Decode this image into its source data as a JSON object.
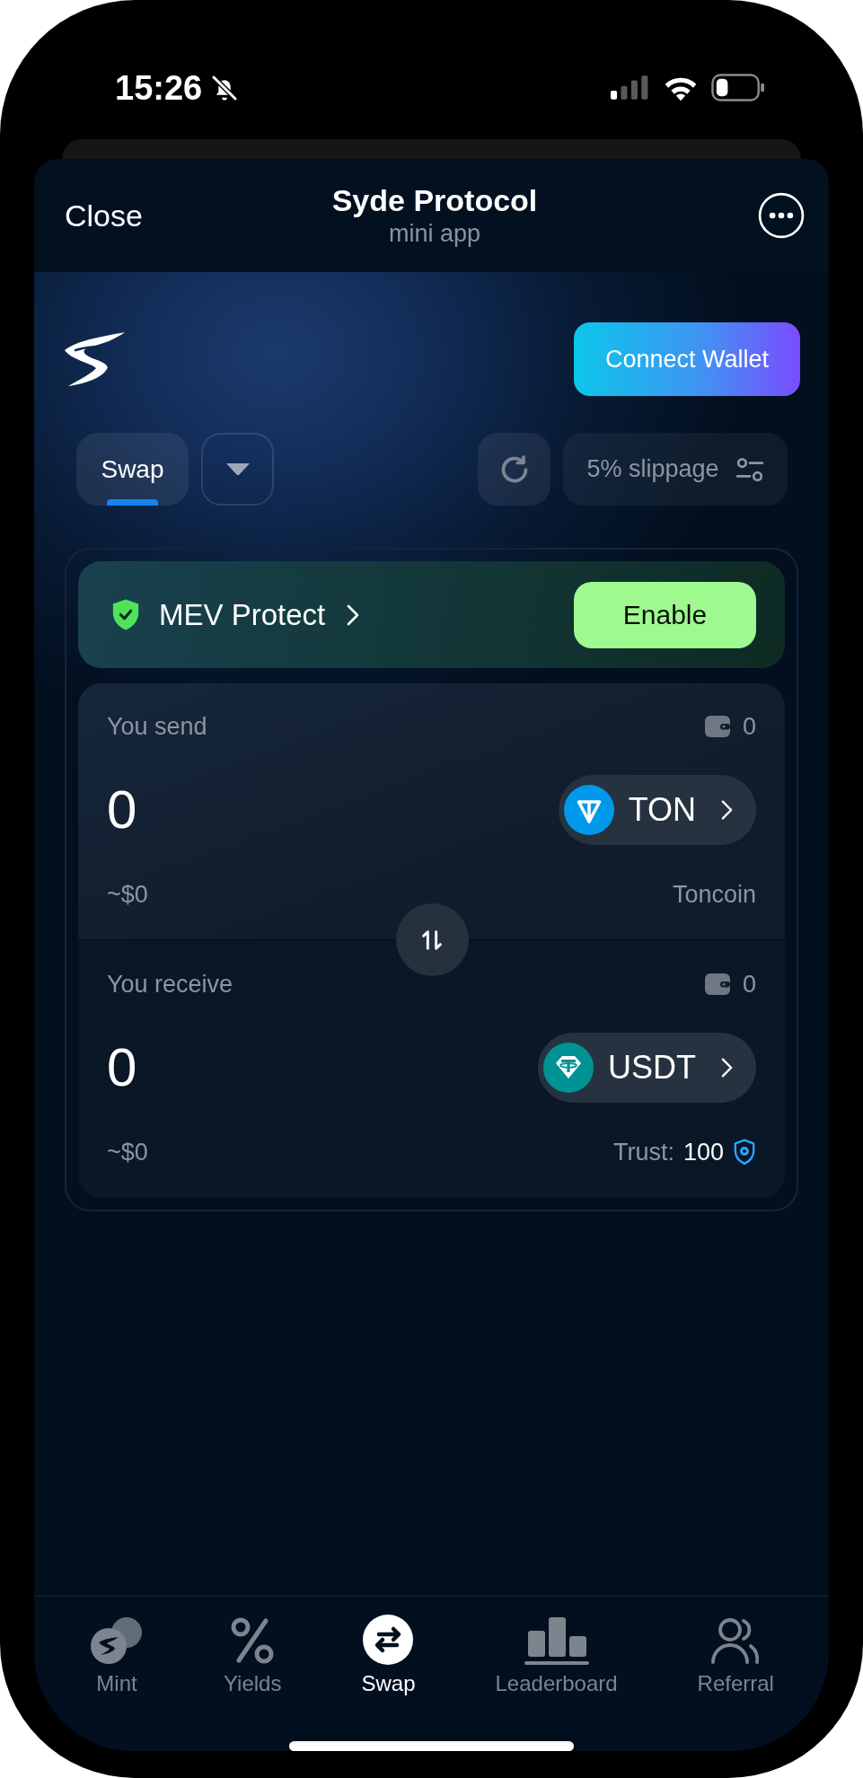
{
  "status_bar": {
    "time": "15:26",
    "silent": true
  },
  "header": {
    "close": "Close",
    "title": "Syde Protocol",
    "subtitle": "mini app"
  },
  "wallet_button": "Connect Wallet",
  "tabs": [
    {
      "label": "Swap",
      "selected": true
    }
  ],
  "slippage": "5% slippage",
  "mev_protect": {
    "title": "MEV Protect",
    "button": "Enable"
  },
  "send": {
    "label": "You send",
    "balance": "0",
    "value": "0",
    "usd": "~$0",
    "token": {
      "kind": "ton",
      "symbol": "TON"
    },
    "note": "Toncoin"
  },
  "receive": {
    "label": "You receive",
    "balance": "0",
    "value": "0",
    "usd": "~$0",
    "token": {
      "kind": "usdt",
      "symbol": "USDT"
    },
    "trust": {
      "label": "Trust:",
      "value": "100"
    }
  },
  "nav": [
    {
      "kind": "mint",
      "label": "Mint",
      "selected": false
    },
    {
      "kind": "yields",
      "label": "Yields",
      "selected": false
    },
    {
      "kind": "swap",
      "label": "Swap",
      "selected": true
    },
    {
      "kind": "leaderboard",
      "label": "Leaderboard",
      "selected": false
    },
    {
      "kind": "referral",
      "label": "Referral",
      "selected": false
    }
  ]
}
